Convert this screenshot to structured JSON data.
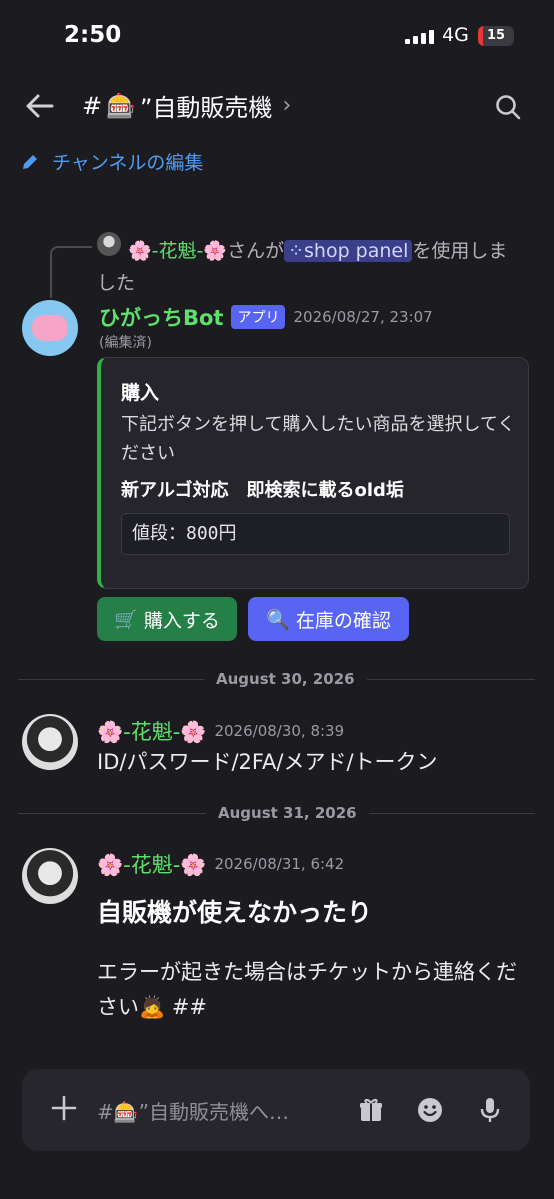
{
  "status_bar": {
    "time": "2:50",
    "network": "4G",
    "battery": "15",
    "battery_level": 0.15
  },
  "header": {
    "hash": "#",
    "channel_emoji": "🎰",
    "channel_name": "”自動販売機",
    "chevron": "›"
  },
  "edit_channel": {
    "label": "チャンネルの編集"
  },
  "reply": {
    "user": "-花魁-",
    "middle": "さんが",
    "command": "shop panel",
    "suffix_line1": "を使用しま",
    "suffix_line2": "した"
  },
  "bot_message": {
    "author": "ひがっちBot",
    "tag": "アプリ",
    "timestamp": "2026/08/27, 23:07",
    "edited": "(編集済)",
    "embed": {
      "title": "購入",
      "description": "下記ボタンを押して購入したい商品を選択してください",
      "field_name": "新アルゴ対応　即検索に載るold垢",
      "price": "値段：800円"
    },
    "buttons": {
      "buy": "購入する",
      "stock": "在庫の確認"
    }
  },
  "dividers": {
    "first": "August 30, 2026",
    "second": "August 31, 2026"
  },
  "messages": [
    {
      "author": "-花魁-",
      "timestamp": "2026/08/30, 8:39",
      "text": "ID/パスワード/2FA/メアド/トークン"
    },
    {
      "author": "-花魁-",
      "timestamp": "2026/08/31, 6:42",
      "heading": "自販機が使えなかったり",
      "text": "エラーが起きた場合はチケットから連絡ください",
      "tail": " ##"
    }
  ],
  "composer": {
    "placeholder": "#🎰”自動販売機へ…"
  },
  "colors": {
    "accent_green": "#5ee06c",
    "blurple": "#5865f2",
    "button_green": "#248046",
    "link_blue": "#4f9cf0"
  }
}
